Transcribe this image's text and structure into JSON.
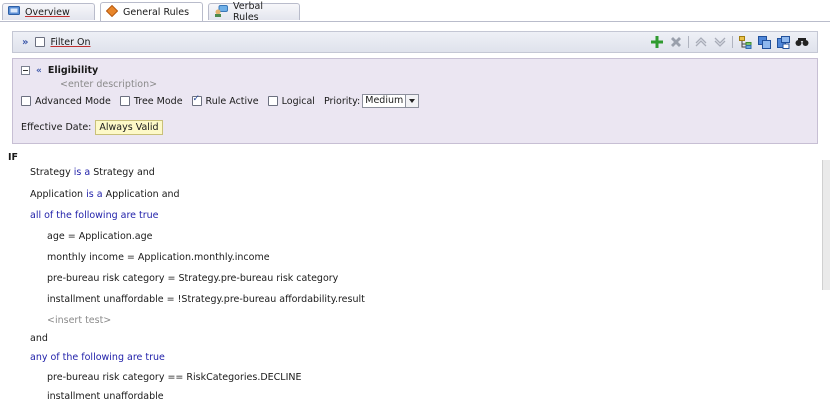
{
  "tabs": [
    {
      "label": "Overview",
      "icon": "overview-icon"
    },
    {
      "label": "General Rules",
      "icon": "diamond-icon"
    },
    {
      "label": "Verbal Rules",
      "icon": "verbal-rules-icon"
    }
  ],
  "toolbar": {
    "filter_label": "Filter On",
    "filter_checked": false,
    "icons": [
      "add-icon",
      "delete-icon",
      "move-up-icon",
      "move-down-icon",
      "tree-icon",
      "copy-icon",
      "paste-icon",
      "find-icon"
    ]
  },
  "rule": {
    "title": "Eligibility",
    "description_placeholder": "<enter description>",
    "options": [
      {
        "label": "Advanced Mode",
        "checked": false
      },
      {
        "label": "Tree Mode",
        "checked": false
      },
      {
        "label": "Rule Active",
        "checked": true
      },
      {
        "label": "Logical",
        "checked": false
      }
    ],
    "priority_label": "Priority:",
    "priority_value": "Medium",
    "effective_label": "Effective Date:",
    "effective_value": "Always Valid"
  },
  "body": {
    "if_label": "IF",
    "line_strategy": {
      "a": "Strategy",
      "b": "is a",
      "c": "Strategy and"
    },
    "line_application": {
      "a": "Application",
      "b": "is a",
      "c": "Application and"
    },
    "all_following": "all of the following are true",
    "tests": [
      "age = Application.age",
      "monthly income = Application.monthly.income",
      "pre-bureau risk category = Strategy.pre-bureau risk category",
      "installment unaffordable = !Strategy.pre-bureau affordability.result"
    ],
    "insert_test": "<insert test>",
    "and_label": "and",
    "any_following": "any of the following are true",
    "any_tests": [
      "pre-bureau risk category  ==  RiskCategories.DECLINE",
      "installment unaffordable"
    ]
  },
  "colors": {
    "keyword": "#2222aa",
    "panel_bg": "#ebe6f2",
    "effective_bg": "#fdf9c8"
  }
}
